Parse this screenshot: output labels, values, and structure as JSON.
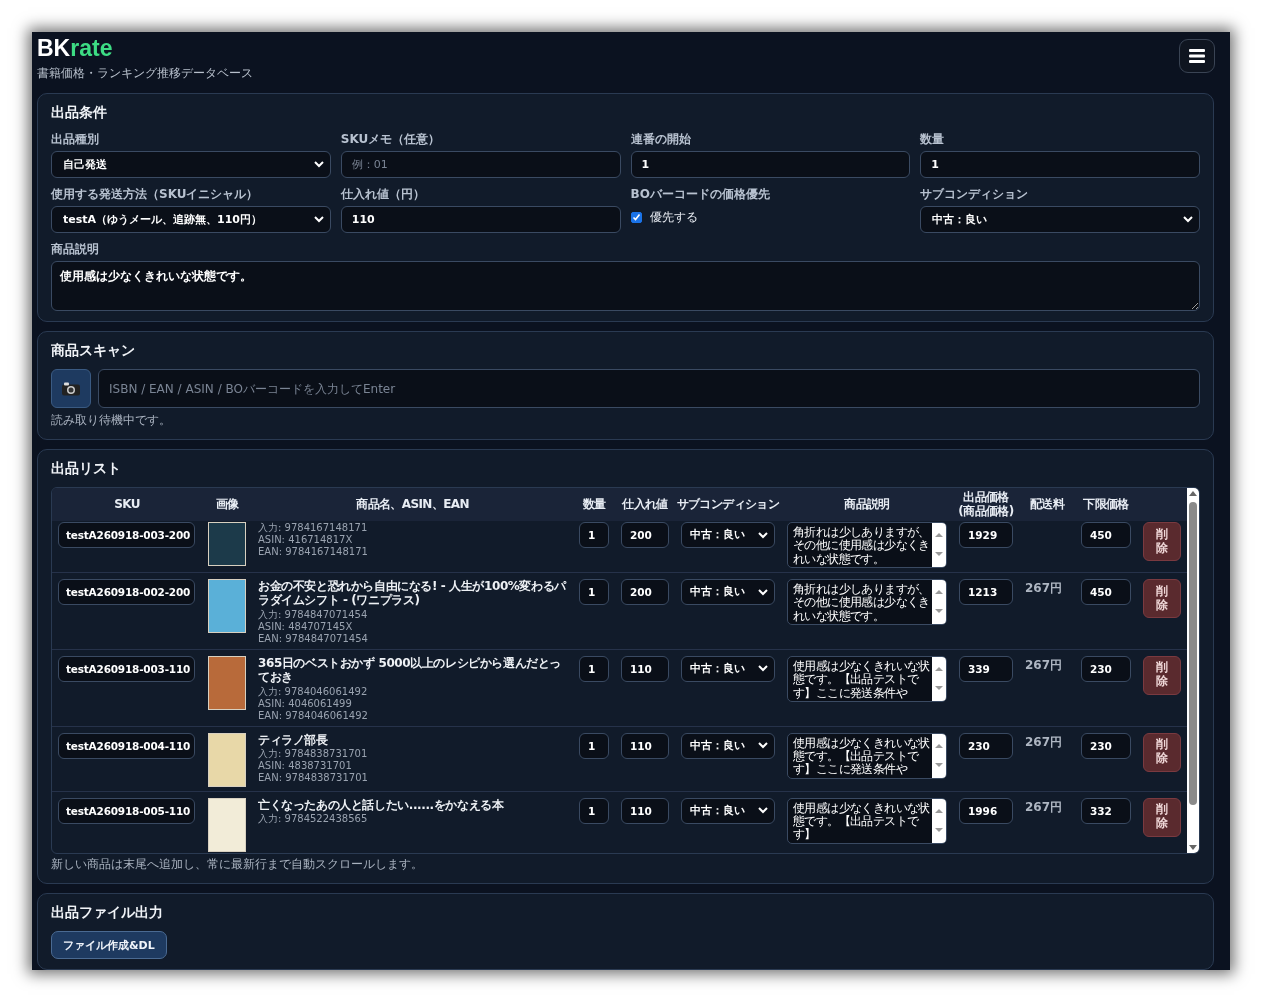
{
  "header": {
    "logo": {
      "main": "BK",
      "accent": "rate"
    },
    "subtitle": "書籍価格・ランキング推移データベース"
  },
  "conditions": {
    "title": "出品条件",
    "fields": [
      {
        "kind": "select",
        "label": "出品種別",
        "value": "自己発送"
      },
      {
        "kind": "input",
        "label": "SKUメモ（任意）",
        "placeholder": "例：01"
      },
      {
        "kind": "input",
        "label": "連番の開始",
        "value": "1"
      },
      {
        "kind": "input",
        "label": "数量",
        "value": "1"
      },
      {
        "kind": "select",
        "label": "使用する発送方法（SKUイニシャル）",
        "value": "testA（ゆうメール、追跡無、110円）"
      },
      {
        "kind": "input",
        "label": "仕入れ値（円）",
        "value": "110"
      },
      {
        "kind": "checkbox",
        "label": "BOバーコードの価格優先",
        "text": "優先する",
        "checked": true
      },
      {
        "kind": "select",
        "label": "サブコンディション",
        "value": "中古：良い"
      }
    ],
    "description": {
      "label": "商品説明",
      "value": "使用感は少なくきれいな状態です。"
    }
  },
  "scan": {
    "title": "商品スキャン",
    "placeholder": "ISBN / EAN / ASIN / BOバーコードを入力してEnter",
    "status": "読み取り待機中です。"
  },
  "listing": {
    "title": "出品リスト",
    "columns": [
      "SKU",
      "画像",
      "商品名、ASIN、EAN",
      "数量",
      "仕入れ値",
      "サブコンディション",
      "商品説明",
      "出品価格\n(商品価格)",
      "配送料",
      "下限価格"
    ],
    "rows": [
      {
        "sku": "testA260918-003-200",
        "input": "入力: 9784167148171",
        "asin": "ASIN: 416714817X",
        "ean": "EAN: 9784167148171",
        "qty": "1",
        "cost": "200",
        "subcondition": "中古：良い",
        "description": "角折れは少しありますが、その他に使用感は少なくきれいな状態です。",
        "price": "1929",
        "min_price": "450",
        "delete": "削除"
      },
      {
        "sku": "testA260918-002-200",
        "title": "お金の不安と恐れから自由になる! - 人生が100%変わるパラダイムシフト - (ワニプラス)",
        "input": "入力: 9784847071454",
        "asin": "ASIN: 484707145X",
        "ean": "EAN: 9784847071454",
        "qty": "1",
        "cost": "200",
        "subcondition": "中古：良い",
        "description": "角折れは少しありますが、その他に使用感は少なくきれいな状態です。",
        "price": "1213",
        "shipping": "267円",
        "min_price": "450",
        "delete": "削除"
      },
      {
        "sku": "testA260918-003-110",
        "title": "365日のベストおかず 5000以上のレシピから選んだとっておき",
        "input": "入力: 9784046061492",
        "asin": "ASIN: 4046061499",
        "ean": "EAN: 9784046061492",
        "qty": "1",
        "cost": "110",
        "subcondition": "中古：良い",
        "description": "使用感は少なくきれいな状態です。【出品テストです】ここに発送条件や",
        "price": "339",
        "shipping": "267円",
        "min_price": "230",
        "delete": "削除"
      },
      {
        "sku": "testA260918-004-110",
        "title": "ティラノ部長",
        "input": "入力: 9784838731701",
        "asin": "ASIN: 4838731701",
        "ean": "EAN: 9784838731701",
        "qty": "1",
        "cost": "110",
        "subcondition": "中古：良い",
        "description": "使用感は少なくきれいな状態です。【出品テストです】ここに発送条件や",
        "price": "230",
        "shipping": "267円",
        "min_price": "230",
        "delete": "削除"
      },
      {
        "sku": "testA260918-005-110",
        "title": "亡くなったあの人と話したい......をかなえる本",
        "input": "入力: 9784522438565",
        "qty": "1",
        "cost": "110",
        "subcondition": "中古：良い",
        "description": "使用感は少なくきれいな状態です。【出品テストです】",
        "price": "1996",
        "shipping": "267円",
        "min_price": "332",
        "delete": "削除"
      }
    ],
    "note": "新しい商品は末尾へ追加し、常に最新行まで自動スクロールします。"
  },
  "export": {
    "title": "出品ファイル出力",
    "button": "ファイル作成&DL"
  }
}
